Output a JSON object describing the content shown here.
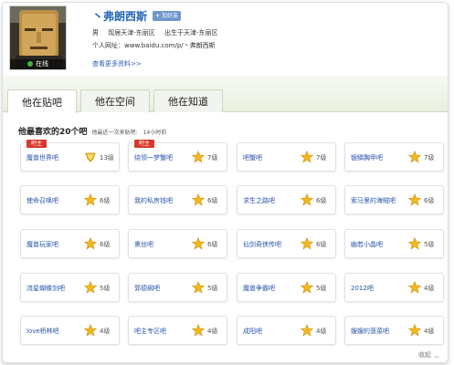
{
  "profile": {
    "name": "弗朗西斯",
    "name_prefix": "丶",
    "add_friend_label": "加好友",
    "status": "在线",
    "gender": "男",
    "location": "现居天津-东丽区",
    "birthplace": "出生于天津-东丽区",
    "homepage_label": "个人网址：",
    "homepage_url": "www.baidu.com/p/丶弗朗西斯",
    "more_link": "查看更多资料>>"
  },
  "tabs": [
    {
      "label": "他在贴吧",
      "active": true
    },
    {
      "label": "他在空间",
      "active": false
    },
    {
      "label": "他在知道",
      "active": false
    }
  ],
  "section": {
    "title": "他最喜欢的20个吧",
    "last_visit_label": "他最近一次来贴吧:",
    "last_visit_value": "14小时前"
  },
  "colors": {
    "link": "#2754a8",
    "owner_badge": "#d8372a",
    "star": "#f2b81c",
    "tab_bg": "#e9f0df"
  },
  "bars": [
    {
      "name": "魔兽世界吧",
      "level": "13级",
      "icon": "gold-medal-icon",
      "owner": "吧主"
    },
    {
      "name": "绕领一梦蟹吧",
      "level": "7级",
      "icon": "star-icon",
      "owner": "吧主"
    },
    {
      "name": "吧蟹吧",
      "level": "7级",
      "icon": "star-icon",
      "owner": ""
    },
    {
      "name": "银鳞胸甲吧",
      "level": "7级",
      "icon": "star-icon",
      "owner": ""
    },
    {
      "name": "使命召唤吧",
      "level": "6级",
      "icon": "star-icon",
      "owner": ""
    },
    {
      "name": "我的私房钱吧",
      "level": "6级",
      "icon": "star-icon",
      "owner": ""
    },
    {
      "name": "求生之路吧",
      "level": "6级",
      "icon": "star-icon",
      "owner": ""
    },
    {
      "name": "索马里的海贼吧",
      "level": "6级",
      "icon": "star-icon",
      "owner": ""
    },
    {
      "name": "魔兽玩家吧",
      "level": "6级",
      "icon": "star-icon",
      "owner": ""
    },
    {
      "name": "熏丝吧",
      "level": "6级",
      "icon": "star-icon",
      "owner": ""
    },
    {
      "name": "仙剑奇侠传吧",
      "level": "6级",
      "icon": "star-icon",
      "owner": ""
    },
    {
      "name": "幽若小晶吧",
      "level": "5级",
      "icon": "star-icon",
      "owner": ""
    },
    {
      "name": "流星蝴蝶剑吧",
      "level": "5级",
      "icon": "star-icon",
      "owner": ""
    },
    {
      "name": "郭德纲吧",
      "level": "5级",
      "icon": "star-icon",
      "owner": ""
    },
    {
      "name": "魔兽争霸吧",
      "level": "5级",
      "icon": "star-icon",
      "owner": ""
    },
    {
      "name": "2012吧",
      "level": "4级",
      "icon": "star-icon",
      "owner": ""
    },
    {
      "name": "love桥林吧",
      "level": "4级",
      "icon": "star-icon",
      "owner": ""
    },
    {
      "name": "吧主专区吧",
      "level": "4级",
      "icon": "star-icon",
      "owner": ""
    },
    {
      "name": "成阳吧",
      "level": "4级",
      "icon": "star-icon",
      "owner": ""
    },
    {
      "name": "嫂嫂的菠菜吧",
      "level": "4级",
      "icon": "star-icon",
      "owner": ""
    }
  ],
  "collapse_label": "收起"
}
